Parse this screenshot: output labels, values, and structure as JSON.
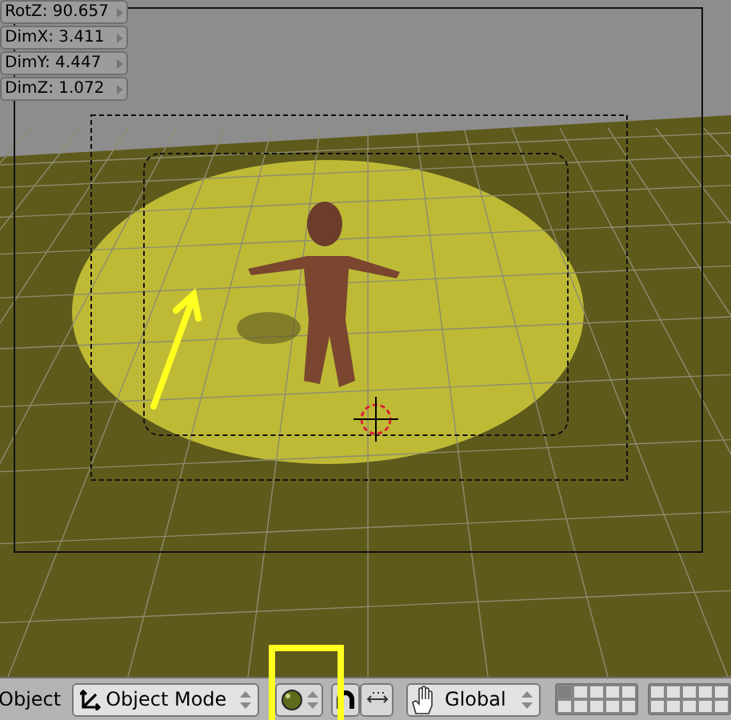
{
  "transform_panel": {
    "fields": [
      "RotZ: 90.657",
      "DimX: 3.411",
      "DimY: 4.447",
      "DimZ: 1.072"
    ]
  },
  "header": {
    "menu": "Object",
    "mode_select": {
      "value": "Object Mode"
    },
    "orientation_select": {
      "value": "Global"
    },
    "layer_groups": [
      {
        "layers": [
          {
            "selected": true
          },
          {
            "selected": false
          },
          {
            "selected": false
          },
          {
            "selected": false
          },
          {
            "selected": false
          },
          {
            "selected": false
          },
          {
            "selected": false
          },
          {
            "selected": false
          },
          {
            "selected": false
          },
          {
            "selected": false
          }
        ]
      },
      {
        "layers": [
          {
            "selected": false
          },
          {
            "selected": false
          },
          {
            "selected": false
          },
          {
            "selected": false
          },
          {
            "selected": false
          },
          {
            "selected": false
          },
          {
            "selected": false
          },
          {
            "selected": false
          },
          {
            "selected": false
          },
          {
            "selected": false
          }
        ]
      }
    ]
  }
}
